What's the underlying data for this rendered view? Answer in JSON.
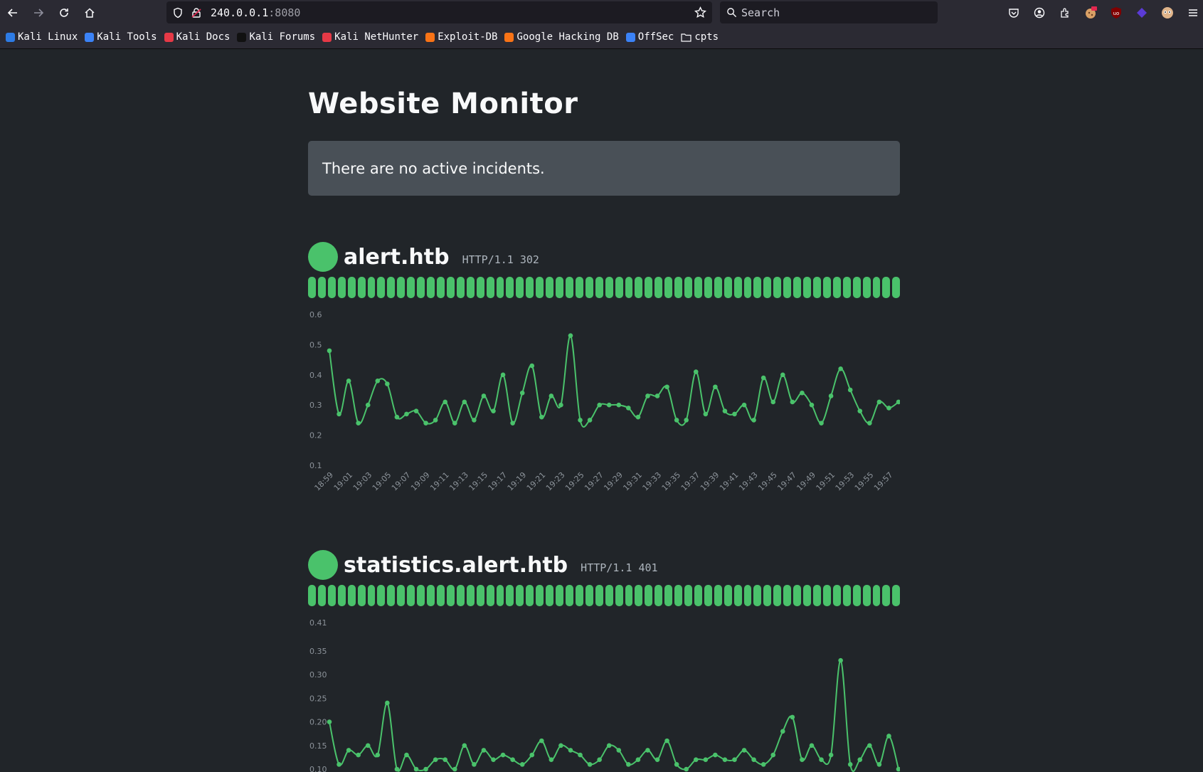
{
  "browser": {
    "url_host": "240.0.0.1",
    "url_port": ":8080",
    "search_placeholder": "Search",
    "bookmarks": [
      {
        "label": "Kali Linux",
        "color": "#2d7be5"
      },
      {
        "label": "Kali Tools",
        "color": "#3b82f6"
      },
      {
        "label": "Kali Docs",
        "color": "#e63946"
      },
      {
        "label": "Kali Forums",
        "color": "#111111"
      },
      {
        "label": "Kali NetHunter",
        "color": "#e63946"
      },
      {
        "label": "Exploit-DB",
        "color": "#f97316"
      },
      {
        "label": "Google Hacking DB",
        "color": "#f97316"
      },
      {
        "label": "OffSec",
        "color": "#3b82f6"
      },
      {
        "label": "cpts",
        "color": "folder"
      }
    ]
  },
  "page": {
    "title": "Website Monitor",
    "incidents_text": "There are no active incidents."
  },
  "sites": [
    {
      "name": "alert.htb",
      "status": "HTTP/1.1 302",
      "beats": 60,
      "chart_data": {
        "type": "line",
        "yticks": [
          0.6,
          0.5,
          0.4,
          0.3,
          0.2,
          0.1
        ],
        "ylim": [
          0.1,
          0.6
        ],
        "xticks": [
          "18:59",
          "19:01",
          "19:03",
          "19:05",
          "19:07",
          "19:09",
          "19:11",
          "19:13",
          "19:15",
          "19:17",
          "19:19",
          "19:21",
          "19:23",
          "19:25",
          "19:27",
          "19:29",
          "19:31",
          "19:33",
          "19:35",
          "19:37",
          "19:39",
          "19:41",
          "19:43",
          "19:45",
          "19:47",
          "19:49",
          "19:51",
          "19:53",
          "19:55",
          "19:57"
        ],
        "values": [
          0.48,
          0.27,
          0.38,
          0.24,
          0.3,
          0.38,
          0.37,
          0.26,
          0.27,
          0.28,
          0.24,
          0.25,
          0.31,
          0.24,
          0.31,
          0.25,
          0.33,
          0.28,
          0.4,
          0.24,
          0.34,
          0.43,
          0.26,
          0.33,
          0.3,
          0.53,
          0.25,
          0.25,
          0.3,
          0.3,
          0.3,
          0.29,
          0.26,
          0.33,
          0.33,
          0.36,
          0.25,
          0.25,
          0.41,
          0.27,
          0.36,
          0.28,
          0.27,
          0.3,
          0.25,
          0.39,
          0.31,
          0.4,
          0.31,
          0.34,
          0.3,
          0.24,
          0.33,
          0.42,
          0.35,
          0.28,
          0.24,
          0.31,
          0.29,
          0.31
        ]
      }
    },
    {
      "name": "statistics.alert.htb",
      "status": "HTTP/1.1 401",
      "beats": 60,
      "chart_data": {
        "type": "line",
        "yticks": [
          0.41,
          0.35,
          0.3,
          0.25,
          0.2,
          0.15,
          0.1
        ],
        "ylim": [
          0.1,
          0.41
        ],
        "values": [
          0.2,
          0.11,
          0.14,
          0.13,
          0.15,
          0.13,
          0.24,
          0.1,
          0.13,
          0.1,
          0.1,
          0.12,
          0.12,
          0.1,
          0.15,
          0.11,
          0.14,
          0.12,
          0.13,
          0.12,
          0.11,
          0.13,
          0.16,
          0.12,
          0.15,
          0.14,
          0.13,
          0.11,
          0.12,
          0.15,
          0.14,
          0.11,
          0.12,
          0.14,
          0.12,
          0.16,
          0.11,
          0.1,
          0.12,
          0.12,
          0.13,
          0.12,
          0.12,
          0.14,
          0.12,
          0.11,
          0.13,
          0.18,
          0.21,
          0.12,
          0.15,
          0.12,
          0.13,
          0.33,
          0.11,
          0.12,
          0.15,
          0.11,
          0.17,
          0.1
        ]
      }
    }
  ],
  "colors": {
    "accent_green": "#4ac26b",
    "page_bg": "#212529",
    "incident_bg": "#495057"
  }
}
